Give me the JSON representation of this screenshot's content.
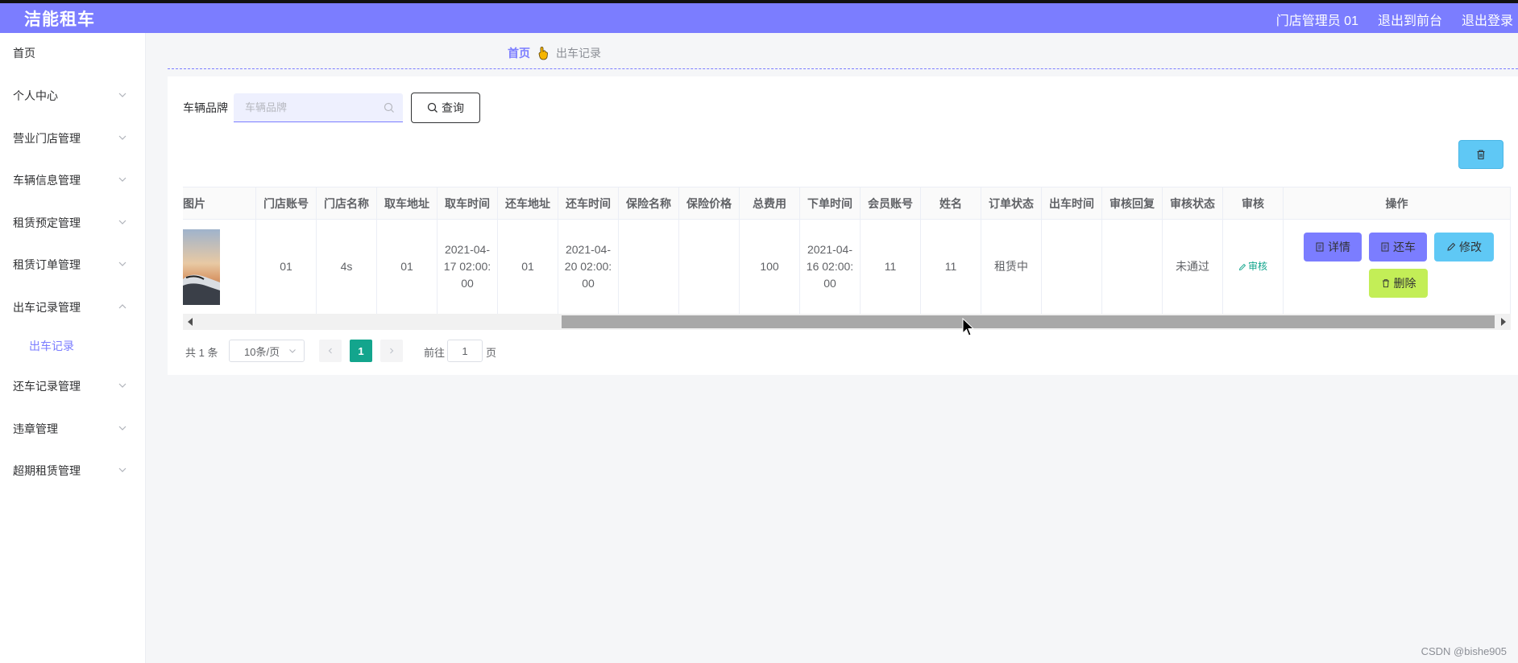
{
  "header": {
    "title": "洁能租车",
    "user_label": "门店管理员 01",
    "to_front_label": "退出到前台",
    "logout_label": "退出登录"
  },
  "sidebar": {
    "items": [
      {
        "label": "首页",
        "has_chevron": false
      },
      {
        "label": "个人中心",
        "has_chevron": true
      },
      {
        "label": "营业门店管理",
        "has_chevron": true
      },
      {
        "label": "车辆信息管理",
        "has_chevron": true
      },
      {
        "label": "租赁预定管理",
        "has_chevron": true
      },
      {
        "label": "租赁订单管理",
        "has_chevron": true
      },
      {
        "label": "出车记录管理",
        "has_chevron": true,
        "expanded": true
      },
      {
        "label": "还车记录管理",
        "has_chevron": true
      },
      {
        "label": "违章管理",
        "has_chevron": true
      },
      {
        "label": "超期租赁管理",
        "has_chevron": true
      }
    ],
    "submenu": {
      "label": "出车记录"
    }
  },
  "breadcrumb": {
    "home": "首页",
    "current": "出车记录"
  },
  "search": {
    "label": "车辆品牌",
    "placeholder": "车辆品牌",
    "value": "",
    "query_label": "查询"
  },
  "table": {
    "columns": [
      "图片",
      "门店账号",
      "门店名称",
      "取车地址",
      "取车时间",
      "还车地址",
      "还车时间",
      "保险名称",
      "保险价格",
      "总费用",
      "下单时间",
      "会员账号",
      "姓名",
      "订单状态",
      "出车时间",
      "审核回复",
      "审核状态",
      "审核",
      "操作"
    ],
    "rows": [
      {
        "store_account": "01",
        "store_name": "4s",
        "pickup_address": "01",
        "pickup_time": "2021-04-17 02:00:00",
        "return_address": "01",
        "return_time": "2021-04-20 02:00:00",
        "insurance_name": "",
        "insurance_price": "",
        "total_fee": "100",
        "order_time": "2021-04-16 02:00:00",
        "member_account": "11",
        "name": "11",
        "order_status": "租赁中",
        "depart_time": "",
        "audit_reply": "",
        "audit_status": "未通过",
        "audit_link": "审核"
      }
    ],
    "actions": {
      "detail": "详情",
      "return_car": "还车",
      "edit": "修改",
      "delete": "删除"
    }
  },
  "pagination": {
    "total": "共 1 条",
    "page_size": "10条/页",
    "current_page": "1",
    "goto_prefix": "前往",
    "goto_value": "1",
    "goto_suffix": "页"
  },
  "watermark": "CSDN @bishe905",
  "colors": {
    "brand": "#7b7dff",
    "accent_blue": "#5fc8f5",
    "accent_lime": "#c3ee57",
    "accent_green": "#13a58d"
  }
}
